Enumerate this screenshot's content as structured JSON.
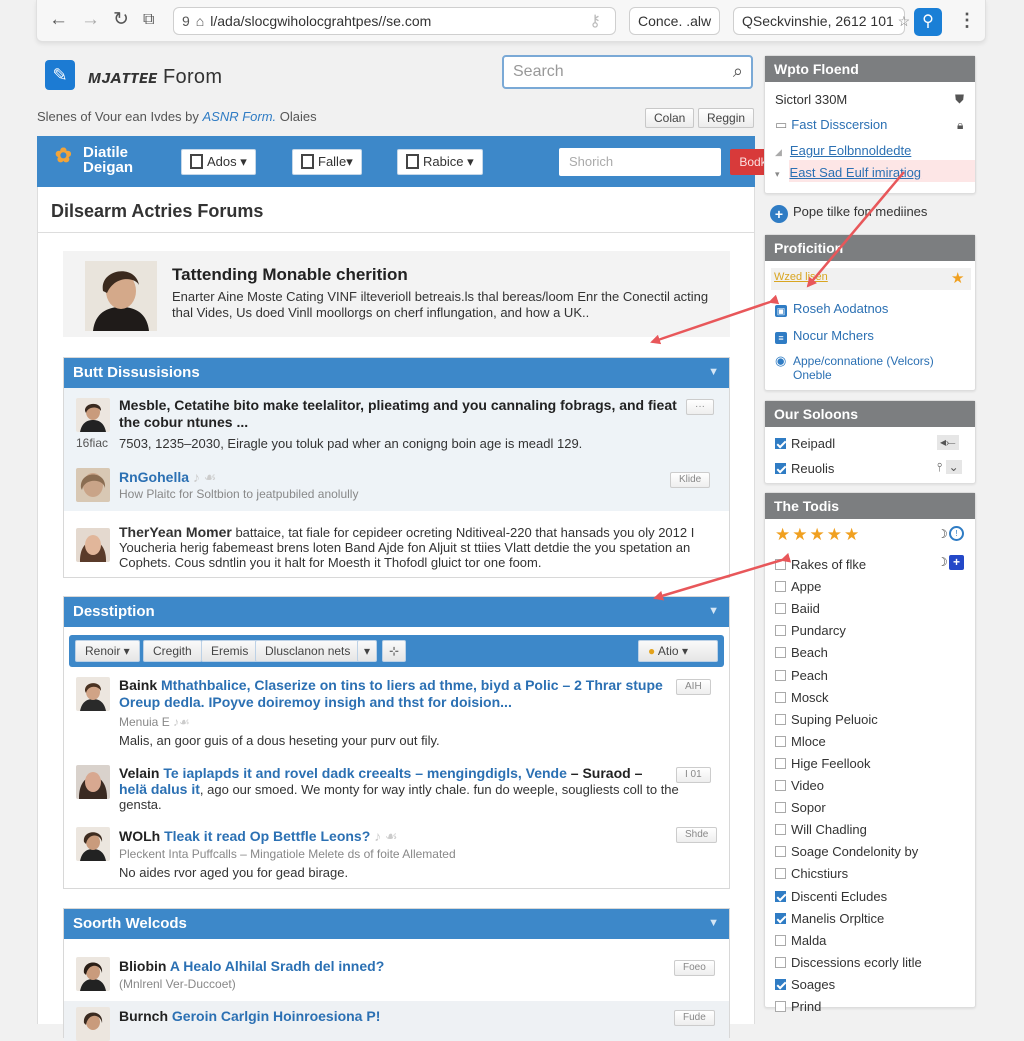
{
  "browser": {
    "url": "l/ada/slocgwiholocgrahtpes//se.com",
    "tab_chip": "Conce. .alw",
    "location_chip": "QSeckvinshie, 2612 101"
  },
  "site": {
    "logo_bold": "ᴍᴊᴀᴛᴛᴇᴇ",
    "logo_name": "Forom",
    "search_placeholder": "Search",
    "tagline_prefix": "Slenes of Vour ean Ivdes by ",
    "tagline_link": "ASNR Form.",
    "tagline_suffix": " Olaies",
    "login_label": "Colan",
    "register_label": "Reggin"
  },
  "navbar": {
    "brand_line1": "Diatile",
    "brand_line2": "Deigan",
    "dropdowns": [
      "Ados",
      "Falle",
      "Rabice"
    ],
    "search_placeholder": "Shorich",
    "go_label": "Bodk"
  },
  "main": {
    "page_title": "Dilsearm Actries Forums",
    "featured": {
      "title": "Tattending Monable cherition",
      "body": "Enarter Aine Moste Cating VINF ilteverioll betreais.ls thal bereas/loom Enr the Conectil acting thal Vides, Us doed Vinll moollorgs on cherf influngation, and how a UK.."
    },
    "sections": [
      {
        "title": "Butt Dissusisions",
        "rows": [
          {
            "title": "Mesble, Cetatihe bito make teelalitor, plieatimg and you cannaling fobrags, and fieat the cobur ntunes ...",
            "meta_prefix": "16fiac",
            "meta": "7503, 1235–2030, Eiragle you toluk pad wher an conigng boin age is meadl 129.",
            "button": "···"
          },
          {
            "author": "RnGohella",
            "sub": "How Plaitc for Soltbion to jeatpubiled anolully",
            "button": "Klide"
          },
          {
            "author": "TherYean Momer",
            "body": " battaice, tat fiale for cepideer ocreting Nditiveal-220 that hansads you oly 2012 I Youcheria herig fabemeast brens loten Band Ajde fon Aljuit st ttiies Vlatt detdie the you spetation an Cophets. Cous sdntlin you it halt for Moesth it Thofodl gluict tor one foom."
          }
        ]
      },
      {
        "title": "Desstiption",
        "toolbar": [
          "Renoir ▾",
          "Cregith",
          "Eremis",
          "Dlusclanon nets",
          "▾",
          "⊹"
        ],
        "toolbar_right": "Atio",
        "rows": [
          {
            "author": "Baink",
            "link": "Mthathbalice, Claserize on tins to liers ad thme, biyd a Polic – 2 Thrar stupe Oreup dedla. IPoyve doiremoy insigh and thst for doision...",
            "sub": "Menuia E",
            "body": "Malis, an goor guis of a dous heseting your purv out fily.",
            "button": "AIH"
          },
          {
            "author": "Velain",
            "link": "Te iaplapds it and rovel dadk creealts – mengingdigls, Vende",
            "mid": " – Suraod – ",
            "link2": "helä dalus it",
            "body": ", ago our smoed. We monty for way intly chale. fun do weeple, sougliests coll to the gensta.",
            "button": "I 01"
          },
          {
            "author": "WOLh",
            "link": "Tleak it read Op Bettfle Leons?",
            "sub": "Pleckent Inta Puffcalls – Mingatiole Melete ds of foite Allemated",
            "body": "No aides rvor aged you for gead birage.",
            "button": "Shde"
          }
        ]
      },
      {
        "title": "Soorth Welcods",
        "rows": [
          {
            "author": "Bliobin",
            "link": "A Healo Alhilal Sradh del inned?",
            "sub": "(Mnlrenl Ver-Duccoet)",
            "button": "Foeo"
          },
          {
            "author": "Burnch",
            "link": "Geroin Carlgin Hoinroesiona P!",
            "button": "Fude"
          }
        ]
      }
    ]
  },
  "sidebar": {
    "who_found": {
      "title": "Wpto Floend",
      "items": [
        {
          "label": "Sictorl 330M"
        },
        {
          "label": "Fast Disscersion"
        },
        {
          "label": "Eagur Eolbnnoldedte"
        },
        {
          "label": "East Sad Eulf imiratiog"
        }
      ]
    },
    "promo_link": "Pope tilke fon mediines",
    "proficition": {
      "title": "Proficition",
      "highlight": "Wzed lisen",
      "items": [
        "Roseh Aodatnos",
        "Nocur Mchers",
        "Appe/connatione (Velcors) Oneble"
      ]
    },
    "our_soloons": {
      "title": "Our Soloons",
      "items": [
        {
          "label": "Reipadl",
          "checked": true
        },
        {
          "label": "Reuolis",
          "checked": true
        }
      ]
    },
    "the_tools": {
      "title": "The Todis",
      "rating_stars": 5,
      "items": [
        {
          "label": "Rakes of flke",
          "checked": false
        },
        {
          "label": "Appe",
          "checked": false
        },
        {
          "label": "Baiid",
          "checked": false
        },
        {
          "label": "Pundarcy",
          "checked": false
        },
        {
          "label": "Beach",
          "checked": false
        },
        {
          "label": "Peach",
          "checked": false
        },
        {
          "label": "Mosck",
          "checked": false
        },
        {
          "label": "Suping Peluoic",
          "checked": false
        },
        {
          "label": "Mloce",
          "checked": false
        },
        {
          "label": "Hige Feellook",
          "checked": false
        },
        {
          "label": "Video",
          "checked": false
        },
        {
          "label": "Sopor",
          "checked": false
        },
        {
          "label": "Will Chadling",
          "checked": false
        },
        {
          "label": "Soage Condelonity by",
          "checked": false
        },
        {
          "label": "Chicstiurs",
          "checked": false
        },
        {
          "label": "Discenti Ecludes",
          "checked": true
        },
        {
          "label": "Manelis Orpltice",
          "checked": true
        },
        {
          "label": "Malda",
          "checked": false
        },
        {
          "label": "Discessions ecorly litle",
          "checked": false
        },
        {
          "label": "Soages",
          "checked": true
        },
        {
          "label": "Prind",
          "checked": false
        }
      ]
    }
  },
  "colors": {
    "accent_blue": "#3d88c9",
    "link_blue": "#2b70b3",
    "sidebar_header": "#7c7e80",
    "go_red": "#d83a3a",
    "annotation_red": "#e8575a"
  }
}
